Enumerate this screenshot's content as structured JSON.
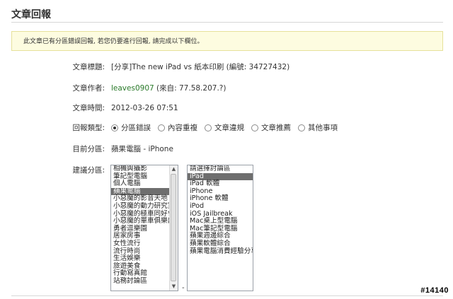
{
  "page": {
    "title": "文章回報"
  },
  "notice": {
    "text": "此文章已有分區錯誤回報, 若您仍要進行回報, 請完成以下欄位。"
  },
  "fields": {
    "article_title": {
      "label": "文章標題:",
      "value": "[分享]The new iPad vs 紙本印刷 (編號: 34727432)"
    },
    "article_author": {
      "label": "文章作者:",
      "author": "leaves0907",
      "source": "(來自: 77.58.207.?)"
    },
    "article_time": {
      "label": "文章時間:",
      "value": "2012-03-26 07:51"
    },
    "report_type": {
      "label": "回報類型:",
      "options": [
        "分區錯誤",
        "內容重複",
        "文章違規",
        "文章推薦",
        "其他事項"
      ],
      "selected": "分區錯誤"
    },
    "current_section": {
      "label": "目前分區:",
      "value": "蘋果電腦 - iPhone"
    },
    "suggested_section": {
      "label": "建議分區:"
    }
  },
  "category_list": {
    "items": [
      "相機與攝影",
      "筆記型電腦",
      "個人電腦",
      "蘋果電腦",
      "小惡魔的影音天地",
      "小惡魔的動力研究室",
      "小惡魔的極車同好會",
      "小惡魔的單車俱樂部",
      "勇者逗樂園",
      "居家房事",
      "女性流行",
      "流行時尚",
      "生活娛樂",
      "旅遊美食",
      "行動寫真館",
      "站務討論區"
    ],
    "selected": "蘋果電腦"
  },
  "subcategory_list": {
    "items": [
      "請選擇討論區",
      "iPad",
      "iPad 軟體",
      "iPhone",
      "iPhone 軟體",
      "iPod",
      "iOS Jailbreak",
      "Mac桌上型電腦",
      "Mac筆記型電腦",
      "蘋果週邊綜合",
      "蘋果軟體綜合",
      "蘋果電腦消費經驗分享"
    ],
    "selected": "iPad"
  },
  "separator": "-",
  "watermark": "#14140"
}
